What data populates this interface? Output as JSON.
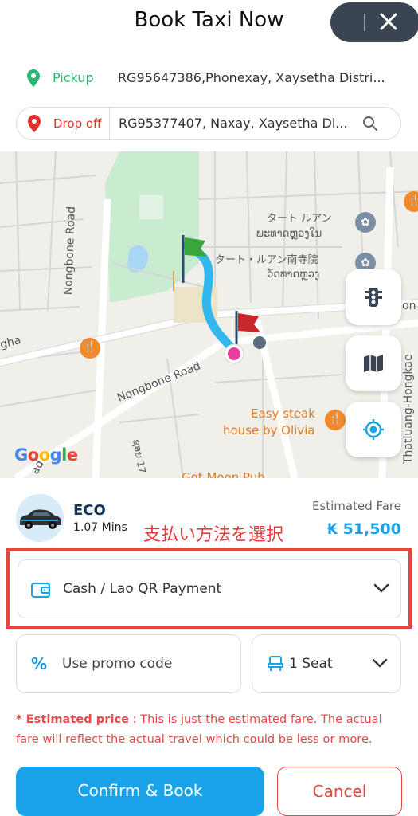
{
  "header": {
    "title": "Book Taxi Now"
  },
  "pickup": {
    "label": "Pickup",
    "address": "RG95647386,Phonexay, Xaysetha Distri..."
  },
  "dropoff": {
    "label": "Drop off",
    "address": "RG95377407, Naxay, Xaysetha Di..."
  },
  "map": {
    "roads": [
      "Nongbone Road",
      "Nongbone Road",
      "Thatluang-Hongkae"
    ],
    "road_fragments": [
      "gha",
      "ad",
      "on",
      "ຊອຍ 17",
      "Got Moon Pub"
    ],
    "temple_labels": [
      "タート ルアン",
      "ພະທາດຫຼວງໃນ",
      "タート・ルアン南寺院",
      "ວັດທາດຫຼວງ"
    ],
    "poi_label_line1": "Easy steak",
    "poi_label_line2": "house by Olivia",
    "brand": [
      "G",
      "o",
      "o",
      "g",
      "l",
      "e"
    ]
  },
  "ride": {
    "name": "ECO",
    "eta": "1.07 Mins",
    "fare_label": "Estimated Fare",
    "fare_value": "₭ 51,500"
  },
  "annotation": "支払い方法を選択",
  "payment": {
    "label": "Cash / Lao QR Payment"
  },
  "promo": {
    "label": "Use promo code"
  },
  "seat": {
    "label": "1 Seat"
  },
  "disclaimer": {
    "title": "* Estimated price",
    "text": " : This is just the estimated fare. The actual fare will reflect the actual travel which could be less or more."
  },
  "buttons": {
    "confirm": "Confirm & Book",
    "cancel": "Cancel"
  },
  "colors": {
    "accent": "#1aa3e8",
    "pickup_green": "#2ab674",
    "danger_red": "#e2463c"
  }
}
